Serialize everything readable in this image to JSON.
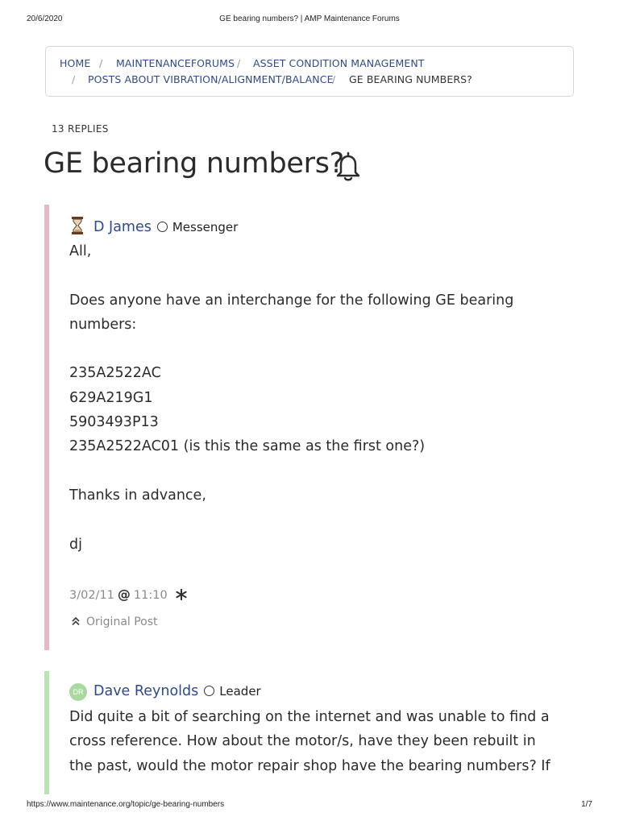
{
  "print_header": {
    "date": "20/6/2020",
    "title": "GE bearing numbers? | AMP Maintenance Forums"
  },
  "breadcrumb": {
    "items": [
      {
        "label": "HOME",
        "separator": "/"
      },
      {
        "label": "MAINTENANCEFORUMS",
        "separator": "/"
      },
      {
        "label": "ASSET CONDITION MANAGEMENT"
      },
      {
        "label": "POSTS ABOUT VIBRATION/ALIGNMENT/BALANCE",
        "separator": "/"
      },
      {
        "label": "GE BEARING NUMBERS?"
      }
    ],
    "line2_separator": "/"
  },
  "topic": {
    "replies": "13 REPLIES",
    "title": "GE bearing numbers?",
    "follow_icon": "bell-icon"
  },
  "posts": [
    {
      "accent_color": "#e8b6c6",
      "author": "D James",
      "avatar_icon": "hourglass-icon",
      "rank": "Messenger",
      "body": [
        "All,",
        "",
        "Does anyone have an interchange for the following GE bearing",
        "numbers:",
        "",
        "235A2522AC",
        "629A219G1",
        "5903493P13",
        "235A2522AC01 (is this the same as the first one?)",
        "",
        "Thanks in advance,",
        "",
        "dj"
      ],
      "date": "3/02/11",
      "at_symbol": "@",
      "time": "11:10",
      "original_post_label": "Original Post"
    },
    {
      "accent_color": "#b8e6b0",
      "author": "Dave Reynolds",
      "avatar_initials": "DR",
      "avatar_color": "#a9d9a0",
      "rank": "Leader",
      "body": [
        "Did quite a bit of searching on the internet and was unable to find a",
        "cross reference. How about the motor/s, have they been rebuilt in",
        "the past, would the motor repair shop have the bearing numbers? If"
      ]
    }
  ],
  "print_footer": {
    "url": "https://www.maintenance.org/topic/ge-bearing-numbers",
    "page": "1/7"
  }
}
